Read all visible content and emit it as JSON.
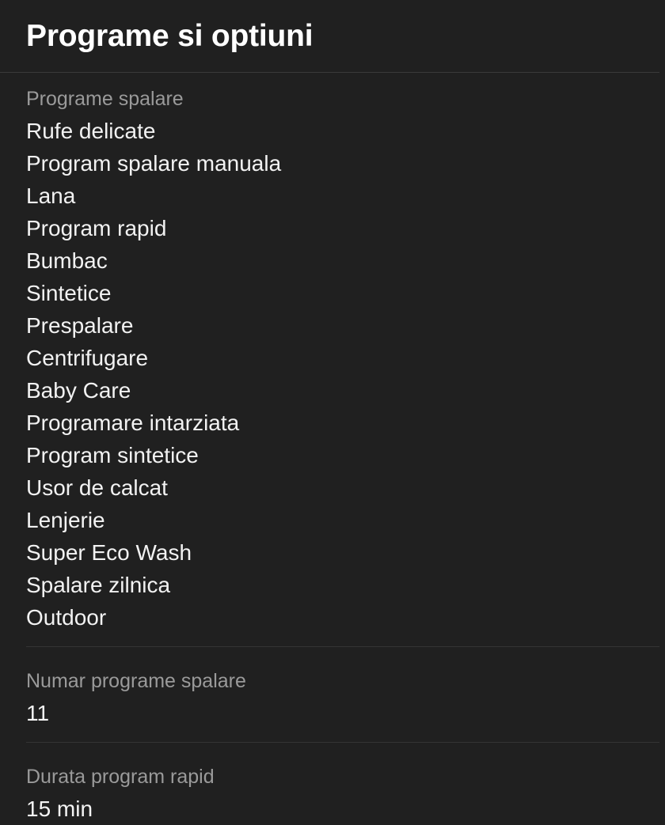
{
  "header": {
    "title": "Programe si optiuni"
  },
  "colors": {
    "background": "#202020",
    "header_background": "#202020",
    "divider": "#3a3a3a",
    "section_divider": "#343434",
    "label_text": "#9a9a9a",
    "value_text": "#f2f2f2",
    "title_text": "#ffffff"
  },
  "sections": [
    {
      "label": "Programe spalare",
      "items": [
        "Rufe delicate",
        "Program spalare manuala",
        "Lana",
        "Program rapid",
        "Bumbac",
        "Sintetice",
        "Prespalare",
        "Centrifugare",
        "Baby Care",
        "Programare intarziata",
        "Program sintetice",
        "Usor de calcat",
        "Lenjerie",
        "Super Eco Wash",
        "Spalare zilnica",
        "Outdoor"
      ]
    },
    {
      "label": "Numar programe spalare",
      "items": [
        "11"
      ]
    },
    {
      "label": "Durata program rapid",
      "items": [
        "15 min"
      ]
    }
  ]
}
